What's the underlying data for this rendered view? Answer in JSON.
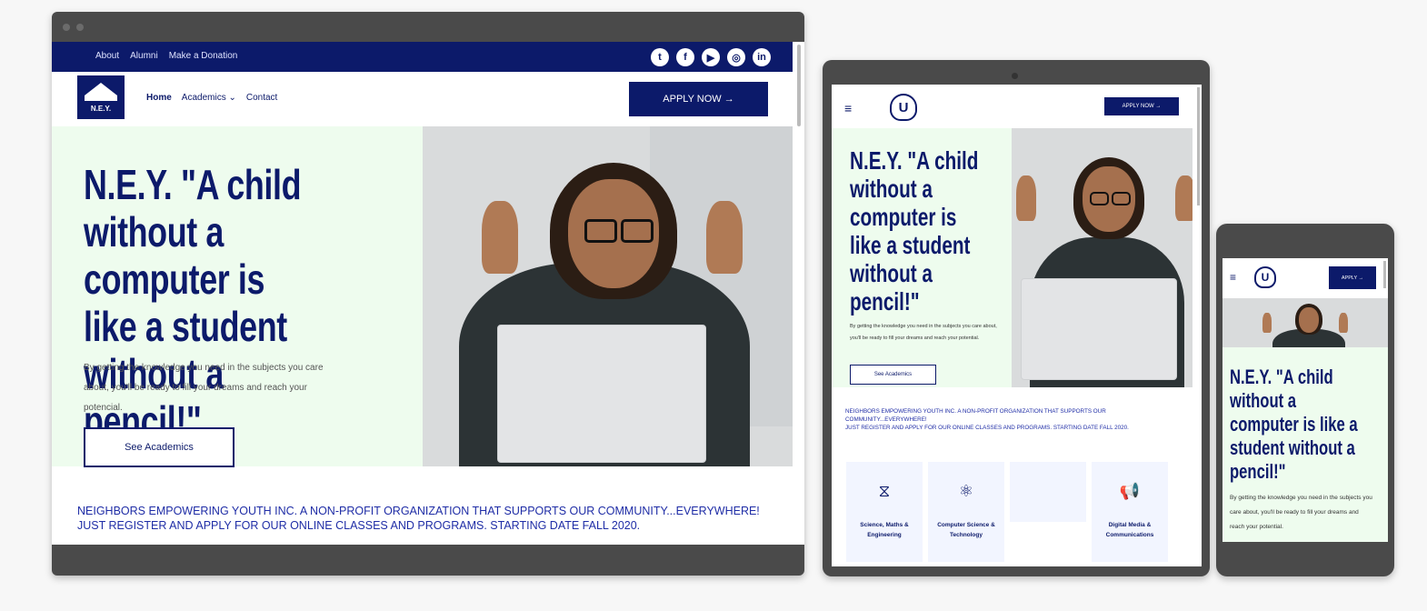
{
  "desktop": {
    "topbar_links": [
      "About",
      "Alumni",
      "Make a Donation"
    ],
    "social_icons": [
      "twitter-icon",
      "facebook-icon",
      "youtube-icon",
      "instagram-icon",
      "linkedin-icon"
    ],
    "social_glyphs": [
      "t",
      "f",
      "▶",
      "◎",
      "in"
    ],
    "logo_text": "N.E.Y.",
    "nav": {
      "home": "Home",
      "academics": "Academics ⌄",
      "contact": "Contact"
    },
    "apply_label": "APPLY NOW →",
    "headline": "N.E.Y. \"A child without a computer is like a student without a pencil!\"",
    "subtext": "By getting the knowledge you need in the subjects you care about, you'll be ready to fill your dreams and reach your potencial.",
    "cta_label": "See Academics",
    "mission_line1": "Neighbors Empowering Youth Inc. A non-profit organization that supports our community...everywhere!",
    "mission_line2": "Just register and apply for our online classes and programs. Starting date fall 2020."
  },
  "tablet": {
    "burger": "≡",
    "crest": "U",
    "apply_label": "APPLY NOW →",
    "headline": "N.E.Y. \"A child without a computer is like a student without a pencil!\"",
    "subtext": "By getting the knowledge you need in the subjects you care about, you'll be ready to fill your dreams and reach your potential.",
    "cta_label": "See Academics",
    "mission_line1": "Neighbors Empowering Youth Inc. A non-profit organization that supports our community...everywhere!",
    "mission_line2": "Just register and apply for our online classes and programs. Starting date fall 2020.",
    "cards": [
      {
        "icon": "dna-icon",
        "glyph": "⧖",
        "label": "Science, Maths & Engineering"
      },
      {
        "icon": "atom-icon",
        "glyph": "⚛",
        "label": "Computer Science & Technology"
      },
      {
        "icon": "",
        "glyph": "",
        "label": ""
      },
      {
        "icon": "megaphone-icon",
        "glyph": "📢",
        "label": "Digital Media & Communications"
      }
    ]
  },
  "phone": {
    "burger": "≡",
    "crest": "U",
    "apply_label": "APPLY →",
    "headline": "N.E.Y. \"A child without a computer is like a student without a pencil!\"",
    "subtext": "By getting the knowledge you need in the subjects you care about, you'll be ready to fill your dreams and reach your potential."
  },
  "colors": {
    "navy": "#0c1a6a",
    "hero_bg": "#eefcee",
    "frame": "#4a4a4a"
  }
}
